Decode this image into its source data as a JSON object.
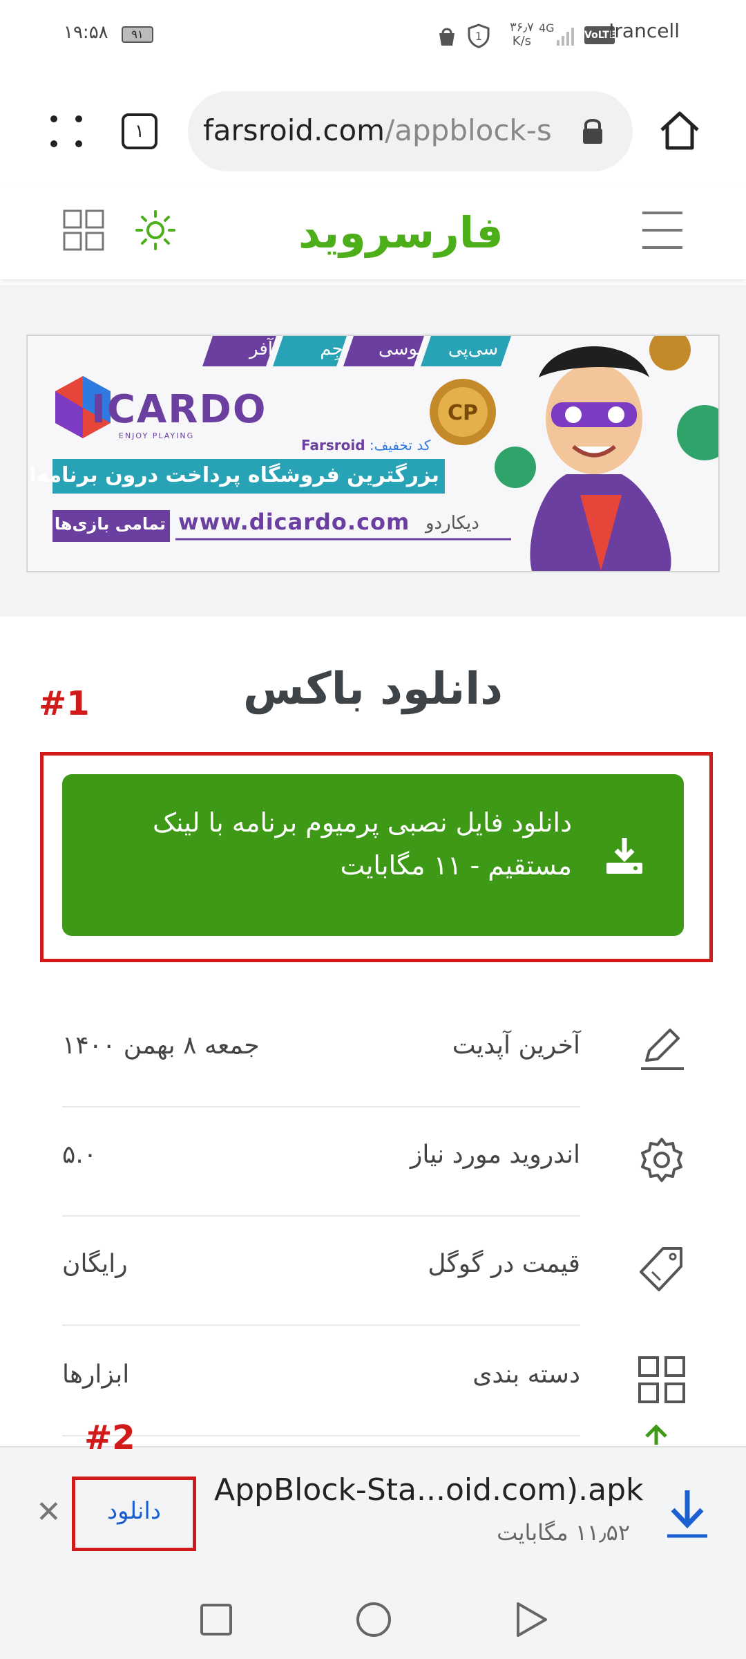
{
  "status_bar": {
    "time": "۱۹:۵۸",
    "battery": "۹۱",
    "net_speed": "۳۶٫۷\nK/s",
    "network_type": "4G",
    "volte": "VoLTE",
    "carrier": "Irancell"
  },
  "browser": {
    "url_host": "farsroid.com",
    "url_rest": "/appblock-s",
    "tab_count": "۱"
  },
  "site": {
    "logo_text": "فارسروید"
  },
  "banner": {
    "brand": "ICARDO",
    "tagline": "ENJOY PLAYING",
    "discount_label": "کد تخفیف:",
    "discount_code": "Farsroid",
    "headline": "بزرگترین فروشگاه پرداخت درون برنامه‌ای",
    "url": "www.dicardo.com",
    "brand_fa": "دیکاردو",
    "all_games": "تمامی بازی‌ها",
    "tabs": [
      "سی‌پی",
      "یوسی",
      "جِم",
      "آفر"
    ],
    "coin": "CP"
  },
  "page": {
    "title": "دانلود باکس",
    "annotation_1": "#1",
    "annotation_2": "#2"
  },
  "download_button": {
    "line1": "دانلود فایل نصبی پرمیوم برنامه با لینک",
    "line2": "مستقیم - ۱۱ مگابایت"
  },
  "info": [
    {
      "label": "آخرین آپدیت",
      "value": "جمعه ۸ بهمن ۱۴۰۰",
      "icon": "pencil-icon"
    },
    {
      "label": "اندروید مورد نیاز",
      "value": "۵.۰",
      "icon": "gear-icon"
    },
    {
      "label": "قیمت در گوگل",
      "value": "رایگان",
      "icon": "price-tag-icon"
    },
    {
      "label": "دسته بندی",
      "value": "ابزارها",
      "icon": "grid-icon"
    }
  ],
  "download_bar": {
    "file_name": "AppBlock-Sta...oid.com).apk",
    "file_size": "۱۱٫۵۲ مگابایت",
    "action": "دانلود"
  },
  "colors": {
    "green": "#3e9a16",
    "logo_green": "#4caf1a",
    "annotation_red": "#d11b1b",
    "link_blue": "#1b5fd1"
  }
}
